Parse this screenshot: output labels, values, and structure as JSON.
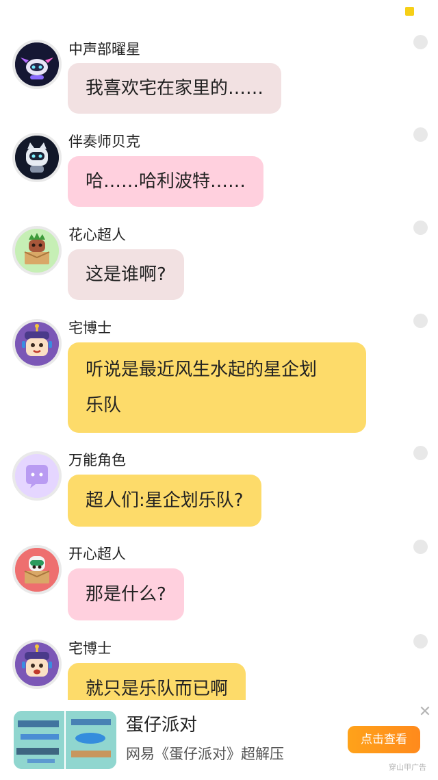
{
  "messages": [
    {
      "name": "中声部曜星",
      "text": "我喜欢宅在家里的……",
      "color": "#f2e1e2",
      "avatar_icon": "robot-star-icon"
    },
    {
      "name": "伴奏师贝克",
      "text": "哈……哈利波特……",
      "color": "#ffd0de",
      "avatar_icon": "robot-cat-icon"
    },
    {
      "name": "花心超人",
      "text": "这是谁啊?",
      "color": "#f2e1e2",
      "avatar_icon": "box-character-green-icon"
    },
    {
      "name": "宅博士",
      "text": "听说是最近风生水起的星企划\n乐队",
      "color": "#fddb6a",
      "avatar_icon": "doctor-character-icon"
    },
    {
      "name": "万能角色",
      "text": "超人们:星企划乐队?",
      "color": "#fddb6a",
      "avatar_icon": "speech-bubble-icon"
    },
    {
      "name": "开心超人",
      "text": "那是什么?",
      "color": "#ffd0de",
      "avatar_icon": "box-character-red-icon"
    },
    {
      "name": "宅博士",
      "text": "就只是乐队而已啊",
      "color": "#fddb6a",
      "avatar_icon": "doctor-character-icon"
    }
  ],
  "ad": {
    "title": "蛋仔派对",
    "subtitle": "网易《蛋仔派对》超解压",
    "cta": "点击查看",
    "close": "✕",
    "source": "穿山甲广告"
  }
}
